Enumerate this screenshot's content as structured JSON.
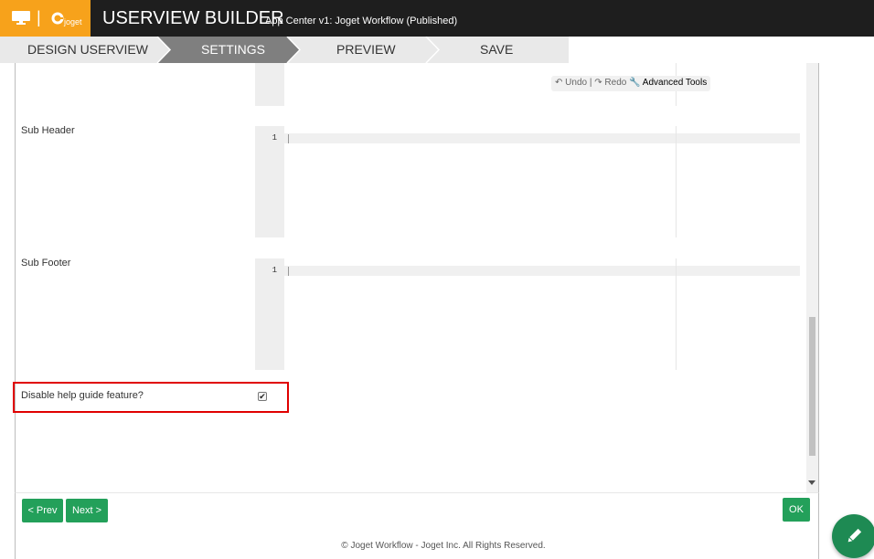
{
  "app": {
    "logo_text": "joget",
    "separator": "|",
    "title": "USERVIEW BUILDER",
    "subtitle": "App Center v1: Joget Workflow (Published)"
  },
  "steps": [
    {
      "label": "DESIGN USERVIEW",
      "active": false
    },
    {
      "label": "SETTINGS",
      "active": true
    },
    {
      "label": "PREVIEW",
      "active": false
    },
    {
      "label": "SAVE",
      "active": false
    }
  ],
  "editor_tools": {
    "undo": "Undo",
    "divider": "|",
    "redo": "Redo",
    "advanced": "Advanced Tools"
  },
  "fields": {
    "sub_header": {
      "label": "Sub Header",
      "line_number": "1"
    },
    "sub_footer": {
      "label": "Sub Footer",
      "line_number": "1"
    },
    "disable_help": {
      "label": "Disable help guide feature?",
      "checked": true
    }
  },
  "buttons": {
    "prev": "< Prev",
    "next": "Next >",
    "ok": "OK"
  },
  "footer": {
    "copyright": "© Joget Workflow - Joget Inc. All Rights Reserved."
  },
  "colors": {
    "brand_orange": "#f7a21b",
    "titlebar": "#1e1e1e",
    "active_step": "#7f7f7f",
    "button_green": "#23a05a",
    "highlight_red": "#e00000"
  },
  "icons": {
    "logo": "monitor-icon",
    "joget": "joget-logo-icon",
    "undo": "undo-icon",
    "redo": "redo-icon",
    "advanced": "wrench-icon",
    "fab": "pencil-icon"
  }
}
